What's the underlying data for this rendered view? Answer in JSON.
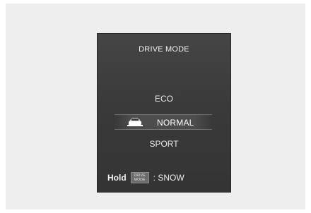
{
  "drive_mode_menu": {
    "title": "DRIVE MODE",
    "options": [
      {
        "label": "ECO",
        "selected": false
      },
      {
        "label": "NORMAL",
        "selected": true,
        "icon": "car-icon"
      },
      {
        "label": "SPORT",
        "selected": false
      }
    ]
  },
  "hold_hint": {
    "hold_label": "Hold",
    "button_lines": [
      "DRIVE",
      "MODE"
    ],
    "action": ": SNOW"
  },
  "colors": {
    "screen_background": "#3a3a3a",
    "text": "#eaeaea",
    "frame_background": "#eeeeee"
  }
}
